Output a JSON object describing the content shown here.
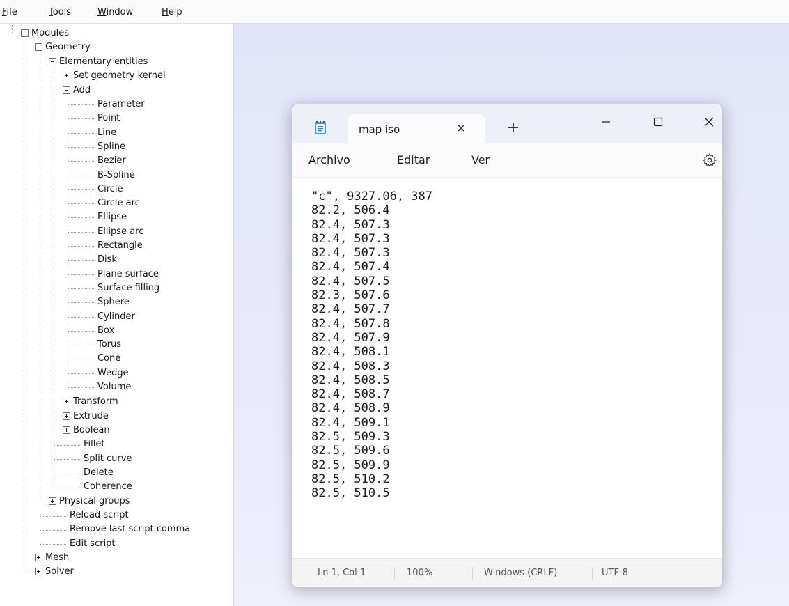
{
  "gmsh": {
    "menu": [
      {
        "hot": "F",
        "rest": "ile"
      },
      {
        "hot": "T",
        "rest": "ools"
      },
      {
        "hot": "W",
        "rest": "indow"
      },
      {
        "hot": "H",
        "rest": "elp"
      }
    ],
    "tree": {
      "modules": "Modules",
      "geometry": "Geometry",
      "elementary": "Elementary entities",
      "set_kernel": "Set geometry kernel",
      "add": "Add",
      "add_items": [
        "Parameter",
        "Point",
        "Line",
        "Spline",
        "Bezier",
        "B-Spline",
        "Circle",
        "Circle arc",
        "Ellipse",
        "Ellipse arc",
        "Rectangle",
        "Disk",
        "Plane surface",
        "Surface filling",
        "Sphere",
        "Cylinder",
        "Box",
        "Torus",
        "Cone",
        "Wedge",
        "Volume"
      ],
      "transform": "Transform",
      "extrude": "Extrude",
      "boolean": "Boolean",
      "fillet": "Fillet",
      "split_curve": "Split curve",
      "delete": "Delete",
      "coherence": "Coherence",
      "physical_groups": "Physical groups",
      "reload_script": "Reload script",
      "remove_last": "Remove last script comma",
      "edit_script": "Edit script",
      "mesh": "Mesh",
      "solver": "Solver"
    }
  },
  "notepad": {
    "tab_title": "map iso",
    "tab_close": "✕",
    "new_tab": "+",
    "menu": [
      "Archivo",
      "Editar",
      "Ver"
    ],
    "content": "\"c\", 9327.06, 387\n82.2, 506.4\n82.4, 507.3\n82.4, 507.3\n82.4, 507.3\n82.4, 507.4\n82.4, 507.5\n82.3, 507.6\n82.4, 507.7\n82.4, 507.8\n82.4, 507.9\n82.4, 508.1\n82.4, 508.3\n82.4, 508.5\n82.4, 508.7\n82.4, 508.9\n82.4, 509.1\n82.5, 509.3\n82.5, 509.6\n82.5, 509.9\n82.5, 510.2\n82.5, 510.5",
    "status": {
      "position": "Ln 1, Col 1",
      "zoom": "100%",
      "line_ending": "Windows (CRLF)",
      "encoding": "UTF-8"
    },
    "icons": [
      "notepad-app-icon",
      "minimize-icon",
      "maximize-icon",
      "close-icon",
      "settings-gear-icon"
    ]
  }
}
